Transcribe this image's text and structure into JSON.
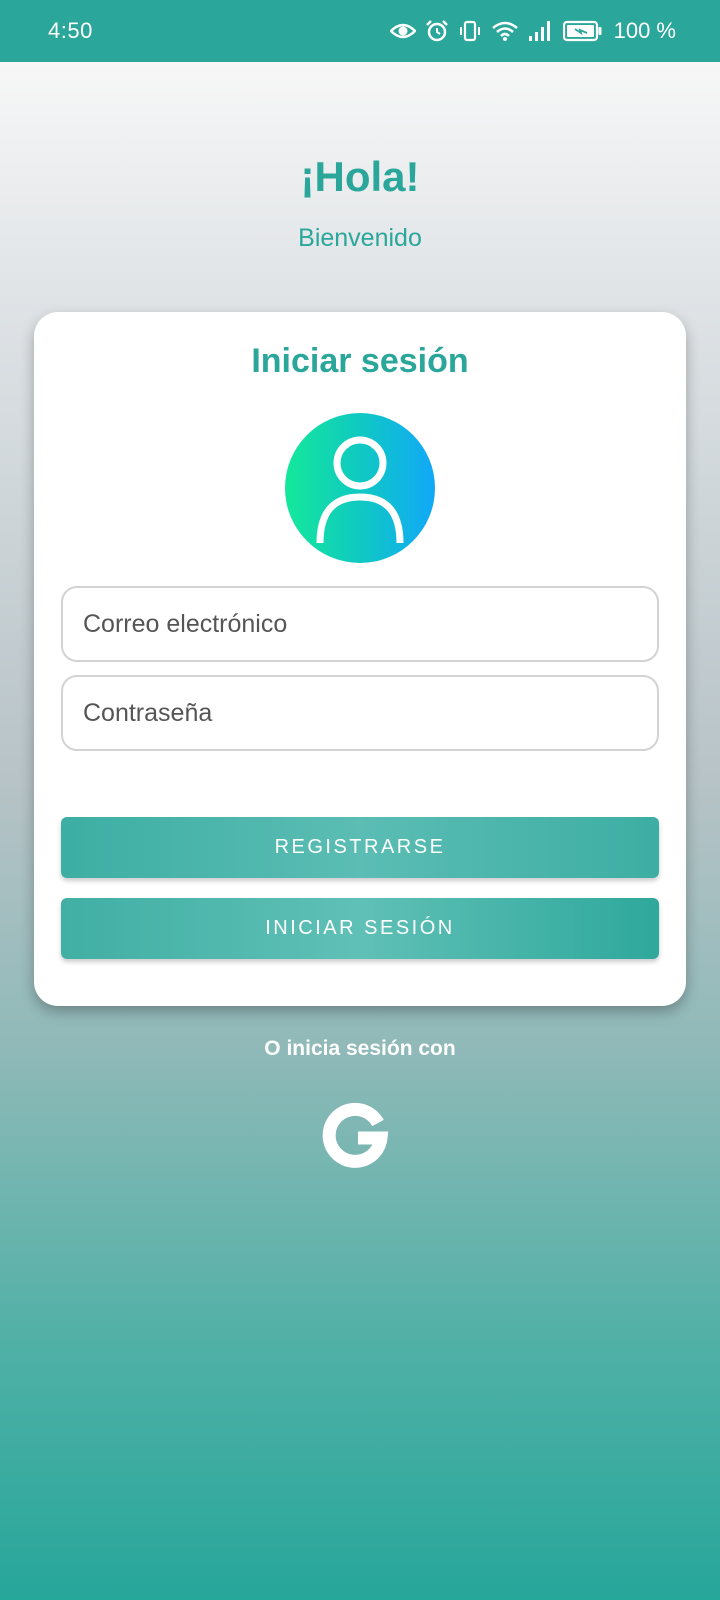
{
  "status_bar": {
    "time": "4:50",
    "battery": "100 %",
    "icons": [
      "eye-icon",
      "alarm-icon",
      "vibrate-icon",
      "wifi-icon",
      "signal-icon",
      "battery-icon"
    ]
  },
  "header": {
    "greeting": "¡Hola!",
    "welcome": "Bienvenido"
  },
  "login_card": {
    "title": "Iniciar sesión",
    "avatar_icon": "user-icon",
    "email_placeholder": "Correo electrónico",
    "password_placeholder": "Contraseña",
    "register_label": "REGISTRARSE",
    "login_label": "INICIAR SESIÓN"
  },
  "social": {
    "text": "O inicia sesión con",
    "google_icon": "google-icon"
  },
  "colors": {
    "primary": "#2ba69a",
    "avatar_gradient": [
      "#14e89a",
      "#11a8f8"
    ],
    "card_background": "#ffffff"
  }
}
